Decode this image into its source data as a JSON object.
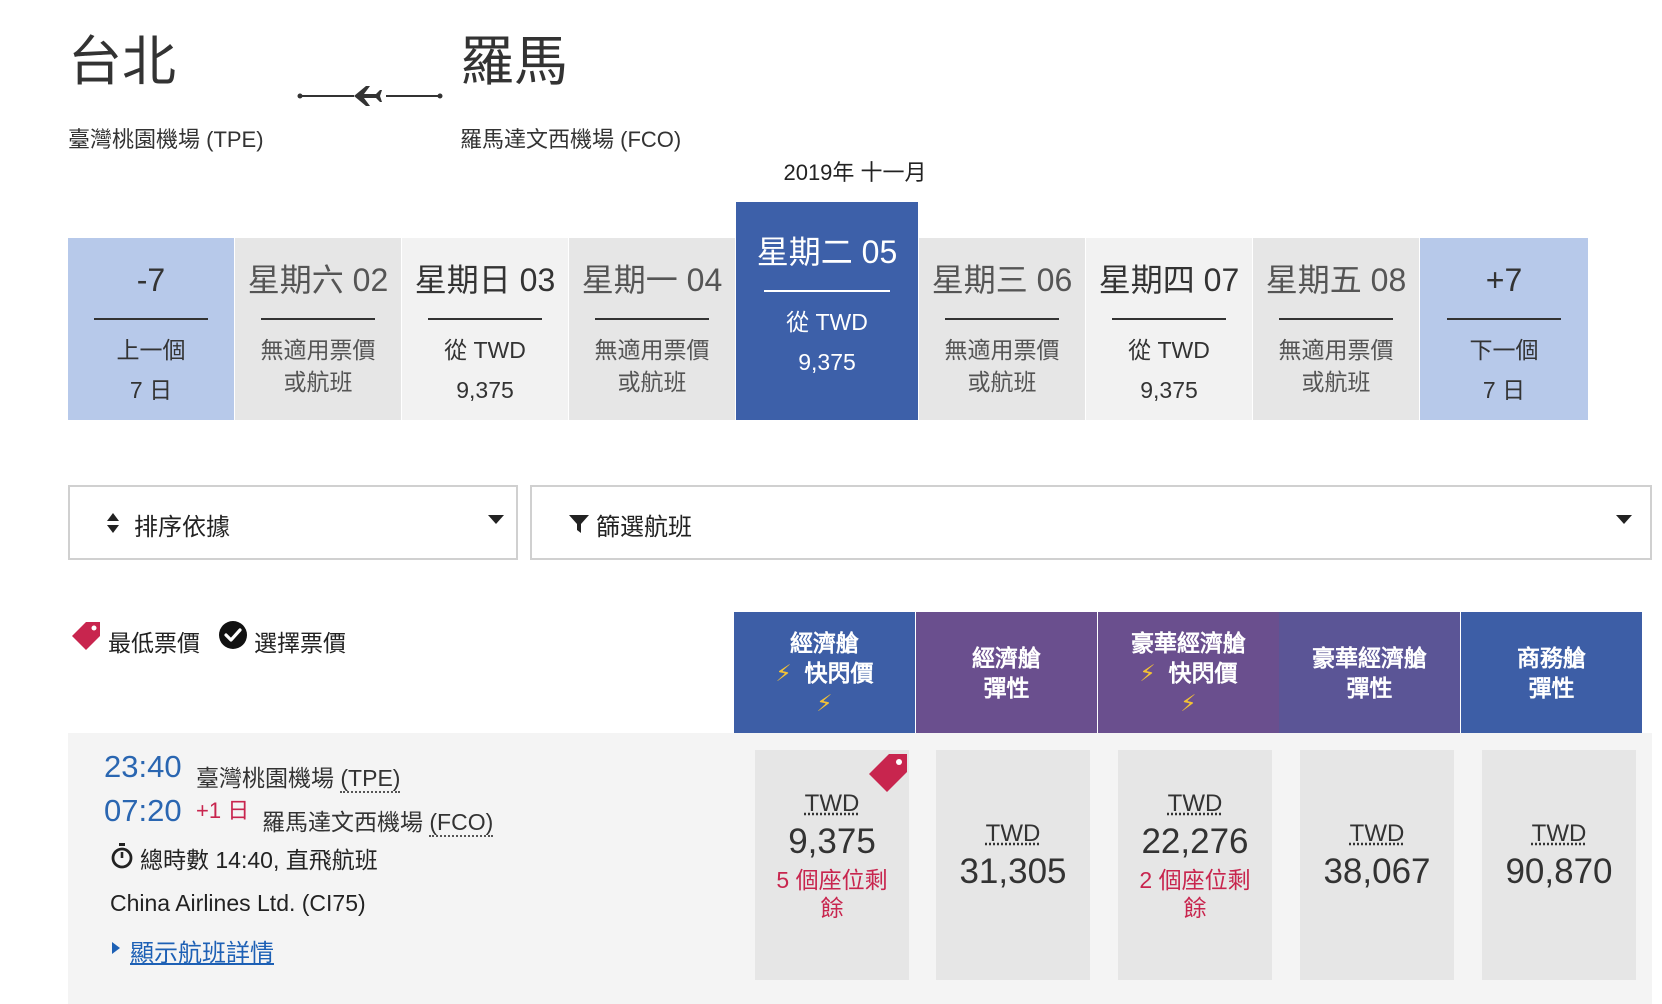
{
  "route": {
    "origin_city": "台北",
    "origin_airport": "臺灣桃園機場 (TPE)",
    "dest_city": "羅馬",
    "dest_airport": "羅馬達文西機場 (FCO)"
  },
  "calendar": {
    "month": "2019年 十一月",
    "prev": {
      "day": "-7",
      "l1": "上一個",
      "l2": "7 日"
    },
    "next": {
      "day": "+7",
      "l1": "下一個",
      "l2": "7 日"
    },
    "days": [
      {
        "day": "星期六 02",
        "l1": "無適用票價",
        "l2": "或航班"
      },
      {
        "day": "星期日 03",
        "l1": "從 TWD",
        "l2": "9,375"
      },
      {
        "day": "星期一 04",
        "l1": "無適用票價",
        "l2": "或航班"
      },
      {
        "day": "星期二 05",
        "l1": "從 TWD",
        "l2": "9,375"
      },
      {
        "day": "星期三 06",
        "l1": "無適用票價",
        "l2": "或航班"
      },
      {
        "day": "星期四 07",
        "l1": "從 TWD",
        "l2": "9,375"
      },
      {
        "day": "星期五 08",
        "l1": "無適用票價",
        "l2": "或航班"
      }
    ]
  },
  "controls": {
    "sort_label": "排序依據",
    "filter_label": "篩選航班"
  },
  "legend": {
    "lowest": "最低票價",
    "selected": "選擇票價"
  },
  "fare_headers": [
    {
      "l1": "經濟艙",
      "l2": "快閃價",
      "color": "#3d5ea6"
    },
    {
      "l1": "經濟艙",
      "l2": "彈性",
      "color": "#6a4f8e"
    },
    {
      "l1": "豪華經濟艙",
      "l2": "快閃價",
      "color": "#6a4f8e"
    },
    {
      "l1": "豪華經濟艙",
      "l2": "彈性",
      "color": "#5b5596"
    },
    {
      "l1": "商務艙",
      "l2": "彈性",
      "color": "#3d5ea6"
    }
  ],
  "flight": {
    "depart_time": "23:40",
    "depart_airport": "臺灣桃園機場",
    "depart_code": "(TPE)",
    "arrive_time": "07:20",
    "arrive_plus": "+1 日",
    "arrive_airport": "羅馬達文西機場",
    "arrive_code": "(FCO)",
    "duration": "總時數 14:40, 直飛航班",
    "carrier": "China Airlines Ltd. (CI75)",
    "details_link": "顯示航班詳情",
    "fares": [
      {
        "currency": "TWD",
        "amount": "9,375",
        "seats": "5 個座位剩餘"
      },
      {
        "currency": "TWD",
        "amount": "31,305",
        "seats": ""
      },
      {
        "currency": "TWD",
        "amount": "22,276",
        "seats": "2 個座位剩餘"
      },
      {
        "currency": "TWD",
        "amount": "38,067",
        "seats": ""
      },
      {
        "currency": "TWD",
        "amount": "90,870",
        "seats": ""
      }
    ]
  },
  "colors": {
    "selected_day": "#3d60a9",
    "nav_cell": "#b7c9ea",
    "time_blue": "#2a66b1",
    "accent_red": "#c8254e"
  },
  "icons": {
    "plane": "airplane-icon",
    "sort": "sort-arrows-icon",
    "filter": "funnel-icon",
    "lowest": "price-tag-icon",
    "selected": "check-circle-icon",
    "flash": "lightning-icon",
    "duration": "stopwatch-icon"
  }
}
